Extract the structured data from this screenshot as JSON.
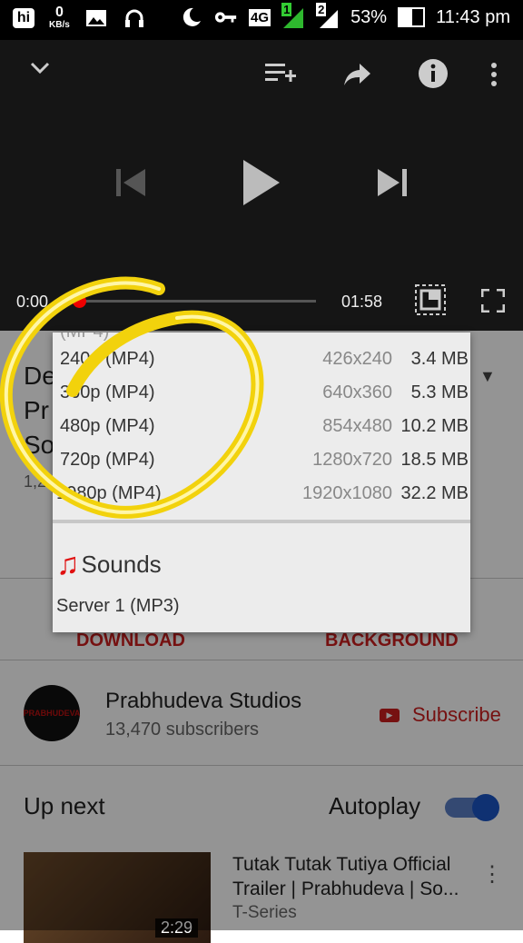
{
  "status_bar": {
    "kbs_value": "0",
    "kbs_unit": "KB/s",
    "network": "4G",
    "sim1": "1",
    "sim2": "2",
    "battery": "53%",
    "time": "11:43 pm"
  },
  "player": {
    "current_time": "0:00",
    "duration": "01:58",
    "progress": 0.0
  },
  "download_menu": {
    "video_options": [
      {
        "format": "240p (MP4)",
        "resolution": "426x240",
        "size": "3.4 MB"
      },
      {
        "format": "360p (MP4)",
        "resolution": "640x360",
        "size": "5.3 MB"
      },
      {
        "format": "480p (MP4)",
        "resolution": "854x480",
        "size": "10.2 MB"
      },
      {
        "format": "720p (MP4)",
        "resolution": "1280x720",
        "size": "18.5 MB"
      },
      {
        "format": "1080p (MP4)",
        "resolution": "1920x1080",
        "size": "32.2 MB"
      }
    ],
    "sounds_label": "Sounds",
    "audio_options": [
      {
        "label": "Server 1 (MP3)"
      }
    ]
  },
  "video_info": {
    "title_fragments": [
      "De",
      "Pr",
      "So"
    ],
    "views_fragment": "1,2"
  },
  "actions": {
    "download": "DOWNLOAD",
    "background": "BACKGROUND"
  },
  "channel": {
    "avatar_text": "PRABHUDEVA",
    "name": "Prabhudeva Studios",
    "subscribers": "13,470 subscribers",
    "subscribe_label": "Subscribe"
  },
  "up_next": {
    "heading": "Up next",
    "autoplay_label": "Autoplay",
    "autoplay_on": true,
    "video": {
      "title": "Tutak Tutak Tutiya Official Trailer | Prabhudeva | So...",
      "channel": "T-Series",
      "duration": "2:29"
    }
  },
  "colors": {
    "accent_red": "#cc1e1e",
    "toggle_blue": "#1a55c4",
    "annotation_yellow": "#f2d20c"
  }
}
